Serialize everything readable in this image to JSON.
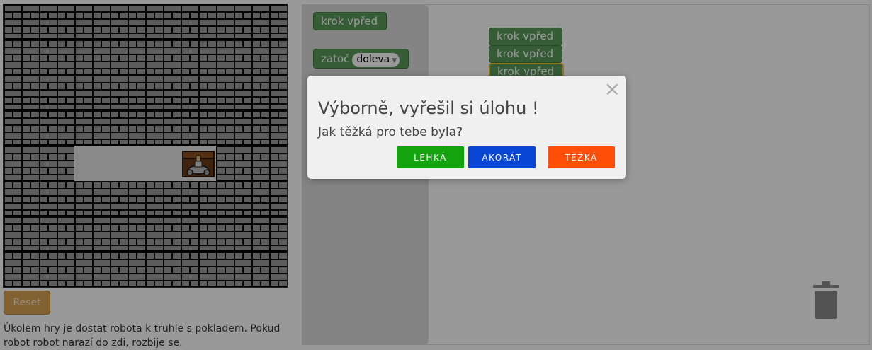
{
  "game": {
    "reset_label": "Reset",
    "task_description": "Úkolem hry je dostat robota k truhle s pokladem. Pokud robot robot narazí do zdi, rozbije se."
  },
  "toolbox": {
    "blocks": [
      {
        "label": "krok vpřed"
      },
      {
        "label": "zatoč",
        "dropdown": "doleva"
      }
    ]
  },
  "workspace": {
    "blocks": [
      {
        "label": "krok vpřed"
      },
      {
        "label": "krok vpřed"
      },
      {
        "label": "krok vpřed",
        "selected": true
      }
    ]
  },
  "modal": {
    "title": "Výborně, vyřešil si úlohu !",
    "question": "Jak těžká pro tebe byla?",
    "close_glyph": "×",
    "buttons": [
      {
        "label": "LEHKÁ",
        "color": "#12a30f"
      },
      {
        "label": "AKORÁT",
        "color": "#0a46d6"
      },
      {
        "label": "TĚŽKÁ",
        "color": "#ff4d0a"
      }
    ]
  },
  "colors": {
    "block_green": "#5b9a5b",
    "selected_outline": "#f5c524",
    "reset_orange": "#d9a455"
  }
}
